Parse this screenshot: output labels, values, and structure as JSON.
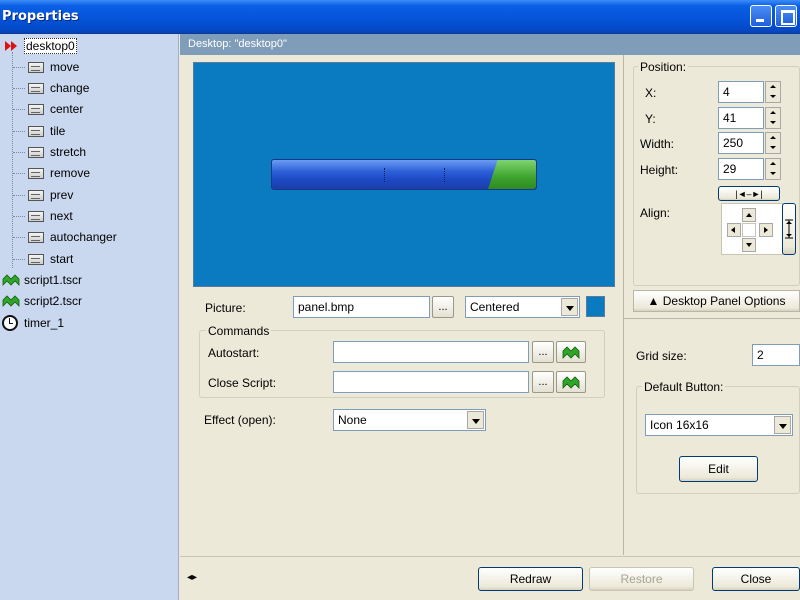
{
  "window": {
    "title": "Properties"
  },
  "tree": {
    "root": {
      "label": "desktop0",
      "icon": "red-arrow-icon"
    },
    "children": [
      {
        "label": "move"
      },
      {
        "label": "change"
      },
      {
        "label": "center"
      },
      {
        "label": "tile"
      },
      {
        "label": "stretch"
      },
      {
        "label": "remove"
      },
      {
        "label": "prev"
      },
      {
        "label": "next"
      },
      {
        "label": "autochanger"
      },
      {
        "label": "start"
      }
    ],
    "others": [
      {
        "label": "script1.tscr",
        "icon": "script-icon"
      },
      {
        "label": "script2.tscr",
        "icon": "script-icon"
      },
      {
        "label": "timer_1",
        "icon": "timer-icon"
      }
    ]
  },
  "header": {
    "title": "Desktop:  \"desktop0\""
  },
  "picture": {
    "label": "Picture:",
    "value": "panel.bmp",
    "browse": "...",
    "mode": "Centered",
    "color": "#0a7bc0"
  },
  "commands": {
    "title": "Commands",
    "autostart_label": "Autostart:",
    "autostart_value": "",
    "close_label": "Close Script:",
    "close_value": "",
    "browse": "..."
  },
  "effect": {
    "label": "Effect (open):",
    "value": "None"
  },
  "position": {
    "title": "Position:",
    "x_label": "X:",
    "x_value": "4",
    "y_label": "Y:",
    "y_value": "41",
    "width_label": "Width:",
    "width_value": "250",
    "height_label": "Height:",
    "height_value": "29",
    "align_label": "Align:",
    "stretch_button": "|◄–►|"
  },
  "options_button": "▲ Desktop Panel Options",
  "grid": {
    "label": "Grid size:",
    "value": "2"
  },
  "default_button": {
    "title": "Default Button:",
    "value": "Icon 16x16",
    "edit": "Edit"
  },
  "footer": {
    "redraw": "Redraw",
    "restore": "Restore",
    "close": "Close",
    "resize_glyph": "◂▸"
  },
  "colors": {
    "titlebar": "#0553d8",
    "tree_bg": "#c9d8ee",
    "header_strip": "#7f9db9",
    "preview_bg": "#0a7bc0"
  }
}
